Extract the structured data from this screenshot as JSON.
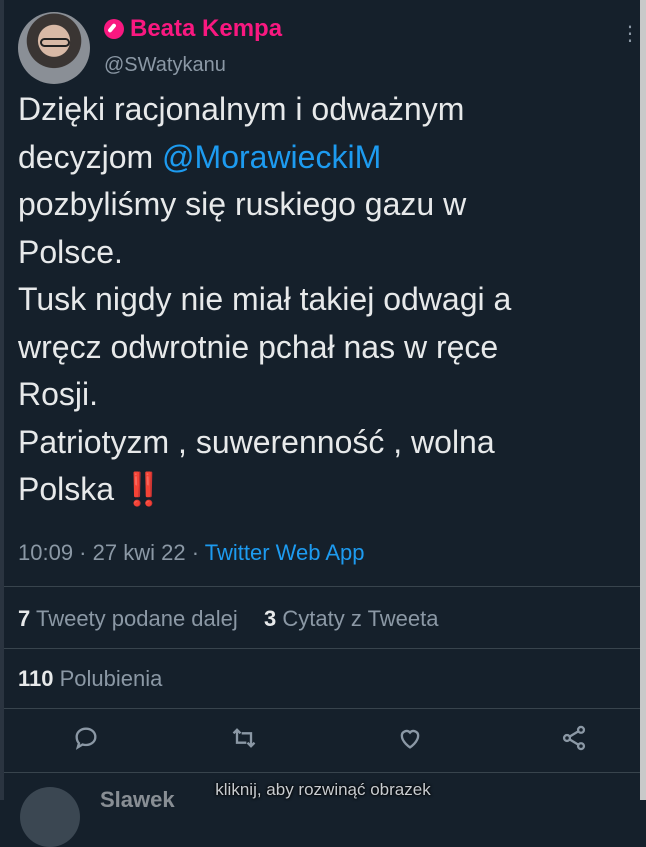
{
  "author": {
    "display_name": "Beata Kempa",
    "handle": "@SWatykanu",
    "avatar_icon": "profile-photo-avatar",
    "verified_icon": "pink-badge-icon"
  },
  "tweet": {
    "line1": "Dzięki racjonalnym i odważnym",
    "line2_prefix": "decyzjom ",
    "mention": "@MorawieckiM",
    "line3": "pozbyliśmy się ruskiego gazu w",
    "line4": "Polsce.",
    "line5": "Tusk nigdy nie miał takiej odwagi a",
    "line6": "wręcz odwrotnie pchał nas w ręce",
    "line7": "Rosji.",
    "line8": "Patriotyzm , suwerenność , wolna",
    "line9_prefix": "Polska ",
    "emoji": "‼️"
  },
  "meta": {
    "time": "10:09",
    "sep1": " · ",
    "date": "27 kwi 22",
    "sep2": " · ",
    "source": "Twitter Web App"
  },
  "stats": {
    "retweets_count": "7",
    "retweets_label": " Tweety podane dalej",
    "quotes_count": "3",
    "quotes_label": " Cytaty z Tweeta",
    "likes_count": "110",
    "likes_label": " Polubienia"
  },
  "actions": {
    "reply_icon": "reply-icon",
    "retweet_icon": "retweet-icon",
    "like_icon": "heart-icon",
    "share_icon": "share-icon"
  },
  "next_tweet": {
    "name_partial": "Slawek"
  },
  "overlay": {
    "expand_caption": "kliknij, aby rozwinąć obrazek"
  },
  "colors": {
    "background": "#15202b",
    "accent": "#1d9bf0",
    "name_pink": "#f91880",
    "muted": "#8b98a5",
    "text": "#e7e9ea"
  }
}
